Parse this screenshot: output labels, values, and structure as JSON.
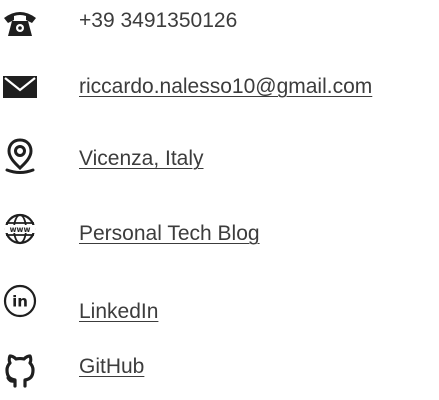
{
  "contacts": [
    {
      "icon": "phone-icon",
      "text": "+39  3491350126",
      "link": false
    },
    {
      "icon": "envelope-icon",
      "text": "riccardo.nalesso10@gmail.com",
      "link": true
    },
    {
      "icon": "location-pin-icon",
      "text": "Vicenza, Italy",
      "link": true
    },
    {
      "icon": "globe-www-icon",
      "text": "Personal Tech Blog",
      "link": true
    },
    {
      "icon": "linkedin-icon",
      "text": "LinkedIn",
      "link": true
    },
    {
      "icon": "github-icon",
      "text": "GitHub",
      "link": true
    }
  ],
  "colors": {
    "icon": "#1f1f1f",
    "text": "#3c3c3c",
    "background": "#ffffff"
  }
}
